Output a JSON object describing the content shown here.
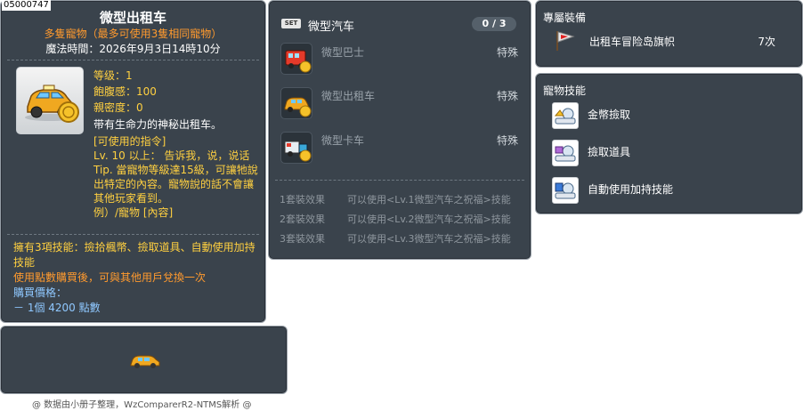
{
  "item_id": "05000747",
  "item": {
    "name": "微型出租车",
    "subtitle": "多隻寵物（最多可使用3隻相同寵物）",
    "magic_time": "魔法時間：2026年9月3日14時10分",
    "stats": {
      "level": "等级：1",
      "fullness": "飽腹感：100",
      "closeness": "親密度：0"
    },
    "description": "带有生命力的神秘出租车。",
    "commands_header": "[可使用的指令]",
    "commands_body": "Lv. 10 以上： 告诉我，说，说话 Tip. 當寵物等級達15級，可讓牠說出特定的內容。寵物說的話不會讓其他玩家看到。",
    "commands_footer": "例）/寵物 [內容]",
    "skills_line": "擁有3項技能：撿拾楓幣、撿取道具、自動使用加持技能",
    "trade_line": "使用點數購買後，可與其他用戶兌換一次",
    "price_label": "購買價格：",
    "price_value": " － 1個 4200 點數"
  },
  "set": {
    "badge": "SET",
    "name": "微型汽车",
    "count": "0 / 3",
    "items": [
      {
        "name": "微型巴士",
        "type": "特殊",
        "icon": "bus-pet-icon"
      },
      {
        "name": "微型出租车",
        "type": "特殊",
        "icon": "taxi-pet-icon"
      },
      {
        "name": "微型卡车",
        "type": "特殊",
        "icon": "truck-pet-icon"
      }
    ],
    "effects": [
      {
        "label": "1套裝效果",
        "text": "可以使用<Lv.1微型汽车之祝福>技能"
      },
      {
        "label": "2套裝效果",
        "text": "可以使用<Lv.2微型汽车之祝福>技能"
      },
      {
        "label": "3套裝效果",
        "text": "可以使用<Lv.3微型汽车之祝福>技能"
      }
    ]
  },
  "exclusive_equip": {
    "title": "專屬裝備",
    "item_name": "出租车冒险岛旗帜",
    "count": "7次"
  },
  "pet_skills": {
    "title": "寵物技能",
    "skills": [
      {
        "name": "金幣撿取"
      },
      {
        "name": "撿取道具"
      },
      {
        "name": "自動使用加持技能"
      }
    ]
  },
  "footer": "@ 数据由小册子整理，WzComparerR2-NTMS解析 @",
  "colors": {
    "panel_bg": "#3a434c",
    "gold": "#ffd040",
    "orange": "#ff9a2e",
    "blue": "#8fc8ff"
  }
}
